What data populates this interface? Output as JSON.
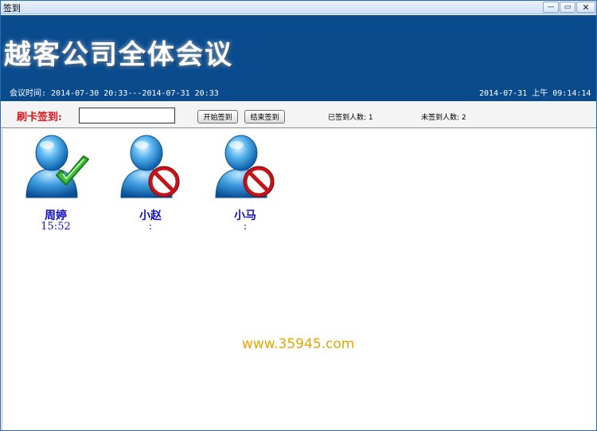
{
  "window": {
    "title": "签到",
    "minimize": "—",
    "maximize": "▭",
    "close": "✕"
  },
  "header": {
    "title": "越客公司全体会议",
    "meeting_time": "会议时间: 2014-07-30 20:33---2014-07-31 20:33",
    "current_time": "2014-07-31 上午 09:14:14"
  },
  "controls": {
    "card_label": "刷卡签到:",
    "card_input_value": "",
    "start_button": "开始签到",
    "end_button": "结束签到",
    "signed_count": "已签到人数: 1",
    "unsigned_count": "未签到人数: 2"
  },
  "attendees": [
    {
      "name": "周婷",
      "time": "15:52",
      "status": "signed",
      "status_icon": "check-icon"
    },
    {
      "name": "小赵",
      "time": ":",
      "status": "not-signed",
      "status_icon": "prohibited-icon"
    },
    {
      "name": "小马",
      "time": ":",
      "status": "not-signed",
      "status_icon": "prohibited-icon"
    }
  ],
  "watermark": "www.35945.com",
  "colors": {
    "header_bg": "#0a4b8e",
    "card_label": "#d8141c",
    "name_text": "#1010c8",
    "watermark": "#e4a600"
  }
}
